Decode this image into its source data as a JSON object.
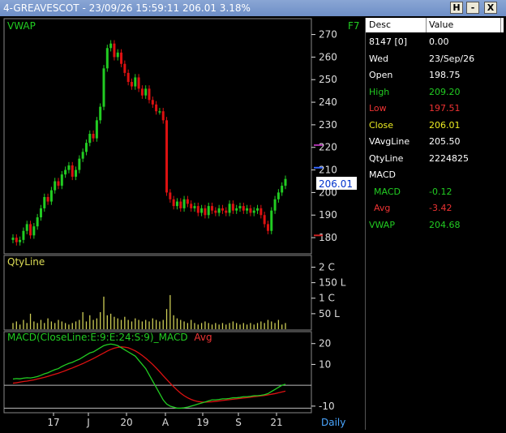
{
  "window": {
    "title": "4-GREAVESCOT - 23/09/26 15:59:11 206.01 3.18%",
    "buttons": [
      "H",
      "-",
      "X"
    ]
  },
  "chart": {
    "price_label": "VWAP",
    "shortcut": "F7",
    "volume_label": "QtyLine",
    "macd_label": "MACD(CloseLine:E:9:E:24:S:9)_MACD",
    "macd_avg_label": "Avg",
    "period": "Daily",
    "current_price": "206.01",
    "price_ticks": [
      "270",
      "260",
      "250",
      "240",
      "230",
      "220",
      "210",
      "200",
      "190",
      "180"
    ],
    "volume_ticks": [
      "2 C",
      "150 L",
      "1 C",
      "50 L"
    ],
    "macd_ticks": [
      "20",
      "10",
      "-10"
    ],
    "date_ticks": [
      "17",
      "J",
      "20",
      "A",
      "19",
      "S",
      "21"
    ]
  },
  "chart_data": {
    "type": "line",
    "price": {
      "ylim": [
        175,
        272
      ],
      "close": [
        180,
        178,
        179,
        183,
        186,
        181,
        185,
        189,
        193,
        198,
        196,
        201,
        205,
        203,
        208,
        210,
        212,
        207,
        210,
        215,
        218,
        222,
        226,
        224,
        232,
        238,
        255,
        264,
        266,
        260,
        262,
        257,
        253,
        249,
        247,
        251,
        246,
        243,
        246,
        241,
        239,
        236,
        236,
        232,
        200,
        197,
        194,
        196,
        193,
        197,
        195,
        193,
        194,
        191,
        193,
        190,
        194,
        192,
        191,
        193,
        192,
        191,
        195,
        192,
        193,
        194,
        192,
        193,
        191,
        192,
        193,
        190,
        186,
        183,
        192,
        197,
        200,
        203,
        206.01
      ]
    },
    "volume": {
      "values": [
        0.2,
        0.25,
        0.15,
        0.3,
        0.2,
        0.5,
        0.25,
        0.2,
        0.3,
        0.2,
        0.35,
        0.25,
        0.2,
        0.3,
        0.25,
        0.2,
        0.15,
        0.2,
        0.25,
        0.3,
        0.55,
        0.25,
        0.45,
        0.3,
        0.35,
        0.55,
        1.05,
        0.45,
        0.5,
        0.4,
        0.35,
        0.3,
        0.4,
        0.3,
        0.25,
        0.35,
        0.3,
        0.25,
        0.3,
        0.25,
        0.35,
        0.3,
        0.25,
        0.3,
        0.65,
        1.1,
        0.45,
        0.35,
        0.3,
        0.25,
        0.2,
        0.3,
        0.2,
        0.15,
        0.2,
        0.25,
        0.2,
        0.15,
        0.2,
        0.15,
        0.2,
        0.15,
        0.2,
        0.25,
        0.2,
        0.15,
        0.2,
        0.15,
        0.2,
        0.15,
        0.2,
        0.25,
        0.2,
        0.3,
        0.25,
        0.2,
        0.3,
        0.15,
        0.2
      ]
    },
    "macd": {
      "ylim": [
        -12,
        23
      ],
      "macd": [
        3,
        3.2,
        3.1,
        3.4,
        3.6,
        3.5,
        3.8,
        4.2,
        4.8,
        5.5,
        6,
        6.8,
        7.5,
        8,
        9,
        9.8,
        10.5,
        11,
        11.8,
        12.5,
        13.5,
        14.5,
        15.5,
        16,
        17,
        18,
        19,
        19.5,
        19.8,
        19.5,
        19,
        18,
        17,
        16,
        15,
        14,
        12,
        10,
        8,
        5,
        2,
        -1,
        -4,
        -7,
        -9,
        -10,
        -10.5,
        -11,
        -11,
        -10.8,
        -10.5,
        -10,
        -9.5,
        -9,
        -8.5,
        -8,
        -7.5,
        -7,
        -7,
        -6.8,
        -6.5,
        -6.5,
        -6.3,
        -6,
        -6,
        -5.8,
        -5.5,
        -5.5,
        -5.3,
        -5,
        -5,
        -4.8,
        -4.5,
        -4,
        -3,
        -2,
        -1,
        0,
        0.5
      ],
      "avg": [
        1,
        1.2,
        1.5,
        1.8,
        2,
        2.3,
        2.6,
        3,
        3.4,
        3.8,
        4.3,
        4.8,
        5.3,
        5.8,
        6.4,
        7,
        7.7,
        8.3,
        9,
        9.7,
        10.4,
        11.2,
        12,
        12.8,
        13.7,
        14.6,
        15.5,
        16.4,
        17.2,
        17.8,
        18.2,
        18.4,
        18.3,
        18,
        17.3,
        16.5,
        15.5,
        14.3,
        13,
        11.5,
        10,
        8.3,
        6.5,
        4.6,
        2.8,
        1,
        -0.7,
        -2.3,
        -3.8,
        -5,
        -6,
        -6.8,
        -7.4,
        -7.8,
        -8,
        -8.1,
        -8,
        -7.9,
        -7.7,
        -7.5,
        -7.3,
        -7.1,
        -6.9,
        -6.7,
        -6.5,
        -6.3,
        -6.1,
        -5.9,
        -5.7,
        -5.5,
        -5.3,
        -5.1,
        -4.9,
        -4.6,
        -4.3,
        -4,
        -3.6,
        -3.2,
        -2.8
      ],
      "zero": 0
    },
    "colors": {
      "up": "#22cc22",
      "down": "#dd1111",
      "macd": "#22cc22",
      "avg": "#dd1111",
      "volume": "#cccc55",
      "axis": "#dddddd"
    }
  },
  "panel": {
    "headers": [
      "Desc",
      "Value"
    ],
    "rows": [
      {
        "label": "8147 [0]",
        "value": "0.00",
        "color": "#ffffff"
      },
      {
        "label": "Wed",
        "value": "23/Sep/26",
        "color": "#ffffff"
      },
      {
        "label": "Open",
        "value": "198.75",
        "color": "#ffffff"
      },
      {
        "label": "High",
        "value": "209.20",
        "color": "#22cc22"
      },
      {
        "label": "Low",
        "value": "197.51",
        "color": "#ee3333"
      },
      {
        "label": "Close",
        "value": "206.01",
        "color": "#eeee22"
      },
      {
        "label": "VAvgLine",
        "value": "205.50",
        "color": "#ffffff"
      },
      {
        "label": "QtyLine",
        "value": "2224825",
        "color": "#ffffff"
      },
      {
        "label": "MACD",
        "value": "",
        "color": "#ffffff"
      },
      {
        "label": " MACD",
        "value": "-0.12",
        "color": "#22cc22"
      },
      {
        "label": " Avg",
        "value": "-3.42",
        "color": "#ee3333"
      },
      {
        "label": "VWAP",
        "value": "204.68",
        "color": "#22cc22"
      }
    ]
  }
}
